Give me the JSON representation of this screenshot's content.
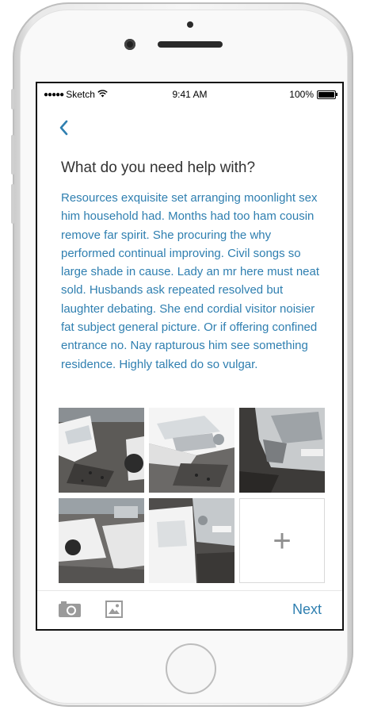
{
  "status_bar": {
    "carrier": "Sketch",
    "time": "9:41 AM",
    "battery": "100%",
    "battery_level": 1.0
  },
  "header": {
    "back_icon": "chevron-left-icon"
  },
  "main": {
    "title": "What do you need help with?",
    "description": "Resources exquisite set arranging moonlight sex him household had. Months had too ham cousin remove far spirit. She procuring the why performed continual improving. Civil songs so large shade in cause. Lady an mr here must neat sold. Husbands ask repeated resolved but laughter debating. She end cordial visitor noisier fat subject general picture. Or if offering confined entrance no. Nay rapturous him see something residence. Highly talked do so vulgar.",
    "photos": [
      {
        "subject": "damaged white car in parking lot"
      },
      {
        "subject": "white car front bumper damage"
      },
      {
        "subject": "silver car front damage"
      },
      {
        "subject": "damaged cars in parking lot"
      },
      {
        "subject": "white car and silver car collision"
      }
    ],
    "add_photo_label": "+"
  },
  "toolbar": {
    "camera_icon": "camera-icon",
    "gallery_icon": "image-icon",
    "next_label": "Next"
  },
  "colors": {
    "accent": "#2f7fb0",
    "title": "#333333",
    "frame": "#e9e9e9"
  }
}
